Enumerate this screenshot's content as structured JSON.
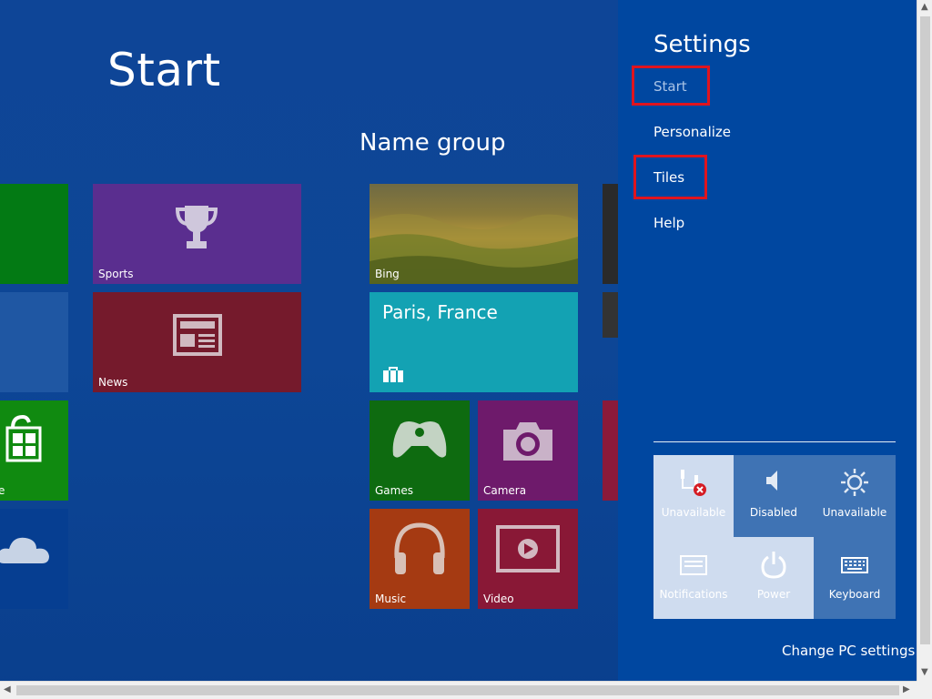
{
  "start": {
    "title": "Start",
    "group_title": "Name group",
    "tiles": {
      "sports": "Sports",
      "news": "News",
      "bing": "Bing",
      "weather_city": "Paris, France",
      "games": "Games",
      "camera": "Camera",
      "music": "Music",
      "video": "Video",
      "store_partial": "e"
    }
  },
  "settings": {
    "title": "Settings",
    "links": [
      "Start",
      "Personalize",
      "Tiles",
      "Help"
    ],
    "quick": [
      {
        "label": "Unavailable",
        "icon": "network-unavailable-icon"
      },
      {
        "label": "Disabled",
        "icon": "volume-icon"
      },
      {
        "label": "Unavailable",
        "icon": "brightness-icon"
      },
      {
        "label": "Notifications",
        "icon": "notifications-icon"
      },
      {
        "label": "Power",
        "icon": "power-icon"
      },
      {
        "label": "Keyboard",
        "icon": "keyboard-icon"
      }
    ],
    "change_pc": "Change PC settings"
  },
  "colors": {
    "background": "#0e4597",
    "charm": "#0047a0",
    "highlight": "#e0141e"
  }
}
